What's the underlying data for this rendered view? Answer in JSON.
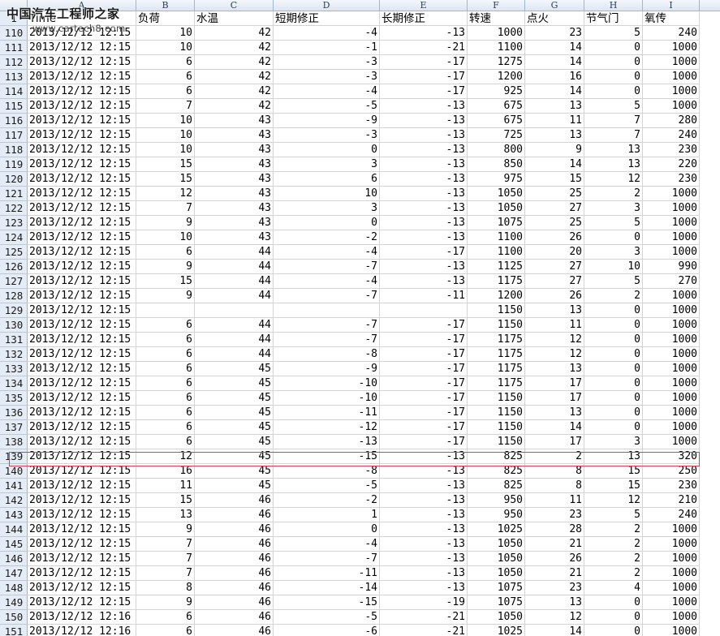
{
  "columns": [
    "A",
    "B",
    "C",
    "D",
    "E",
    "F",
    "G",
    "H",
    "I"
  ],
  "headers": [
    "Time",
    "负荷",
    "水温",
    "短期修正",
    "长期修正",
    "转速",
    "点火",
    "节气门",
    "氧传"
  ],
  "header_row_num": "1",
  "rows": [
    {
      "n": "110",
      "v": [
        "2013/12/12 12:15",
        "10",
        "42",
        "-4",
        "-13",
        "1000",
        "23",
        "5",
        "240"
      ]
    },
    {
      "n": "111",
      "v": [
        "2013/12/12 12:15",
        "10",
        "42",
        "-1",
        "-21",
        "1100",
        "14",
        "0",
        "1000"
      ]
    },
    {
      "n": "112",
      "v": [
        "2013/12/12 12:15",
        "6",
        "42",
        "-3",
        "-17",
        "1275",
        "14",
        "0",
        "1000"
      ]
    },
    {
      "n": "113",
      "v": [
        "2013/12/12 12:15",
        "6",
        "42",
        "-3",
        "-17",
        "1200",
        "16",
        "0",
        "1000"
      ]
    },
    {
      "n": "114",
      "v": [
        "2013/12/12 12:15",
        "6",
        "42",
        "-4",
        "-17",
        "925",
        "14",
        "0",
        "1000"
      ]
    },
    {
      "n": "115",
      "v": [
        "2013/12/12 12:15",
        "7",
        "42",
        "-5",
        "-13",
        "675",
        "13",
        "5",
        "1000"
      ]
    },
    {
      "n": "116",
      "v": [
        "2013/12/12 12:15",
        "10",
        "43",
        "-9",
        "-13",
        "675",
        "11",
        "7",
        "280"
      ]
    },
    {
      "n": "117",
      "v": [
        "2013/12/12 12:15",
        "10",
        "43",
        "-3",
        "-13",
        "725",
        "13",
        "7",
        "240"
      ]
    },
    {
      "n": "118",
      "v": [
        "2013/12/12 12:15",
        "10",
        "43",
        "0",
        "-13",
        "800",
        "9",
        "13",
        "230"
      ]
    },
    {
      "n": "119",
      "v": [
        "2013/12/12 12:15",
        "15",
        "43",
        "3",
        "-13",
        "850",
        "14",
        "13",
        "220"
      ]
    },
    {
      "n": "120",
      "v": [
        "2013/12/12 12:15",
        "15",
        "43",
        "6",
        "-13",
        "975",
        "15",
        "12",
        "230"
      ]
    },
    {
      "n": "121",
      "v": [
        "2013/12/12 12:15",
        "12",
        "43",
        "10",
        "-13",
        "1050",
        "25",
        "2",
        "1000"
      ]
    },
    {
      "n": "122",
      "v": [
        "2013/12/12 12:15",
        "7",
        "43",
        "3",
        "-13",
        "1050",
        "27",
        "3",
        "1000"
      ]
    },
    {
      "n": "123",
      "v": [
        "2013/12/12 12:15",
        "9",
        "43",
        "0",
        "-13",
        "1075",
        "25",
        "5",
        "1000"
      ]
    },
    {
      "n": "124",
      "v": [
        "2013/12/12 12:15",
        "10",
        "43",
        "-2",
        "-13",
        "1100",
        "26",
        "0",
        "1000"
      ]
    },
    {
      "n": "125",
      "v": [
        "2013/12/12 12:15",
        "6",
        "44",
        "-4",
        "-17",
        "1100",
        "20",
        "3",
        "1000"
      ]
    },
    {
      "n": "126",
      "v": [
        "2013/12/12 12:15",
        "9",
        "44",
        "-7",
        "-13",
        "1125",
        "27",
        "10",
        "990"
      ]
    },
    {
      "n": "127",
      "v": [
        "2013/12/12 12:15",
        "15",
        "44",
        "-4",
        "-13",
        "1175",
        "27",
        "5",
        "270"
      ]
    },
    {
      "n": "128",
      "v": [
        "2013/12/12 12:15",
        "9",
        "44",
        "-7",
        "-11",
        "1200",
        "26",
        "2",
        "1000"
      ]
    },
    {
      "n": "129",
      "v": [
        "2013/12/12 12:15",
        "",
        "",
        "",
        "",
        "1150",
        "13",
        "0",
        "1000"
      ]
    },
    {
      "n": "130",
      "v": [
        "2013/12/12 12:15",
        "6",
        "44",
        "-7",
        "-17",
        "1150",
        "11",
        "0",
        "1000"
      ]
    },
    {
      "n": "131",
      "v": [
        "2013/12/12 12:15",
        "6",
        "44",
        "-7",
        "-17",
        "1175",
        "12",
        "0",
        "1000"
      ]
    },
    {
      "n": "132",
      "v": [
        "2013/12/12 12:15",
        "6",
        "44",
        "-8",
        "-17",
        "1175",
        "12",
        "0",
        "1000"
      ]
    },
    {
      "n": "133",
      "v": [
        "2013/12/12 12:15",
        "6",
        "45",
        "-9",
        "-17",
        "1175",
        "13",
        "0",
        "1000"
      ]
    },
    {
      "n": "134",
      "v": [
        "2013/12/12 12:15",
        "6",
        "45",
        "-10",
        "-17",
        "1175",
        "17",
        "0",
        "1000"
      ]
    },
    {
      "n": "135",
      "v": [
        "2013/12/12 12:15",
        "6",
        "45",
        "-10",
        "-17",
        "1150",
        "17",
        "0",
        "1000"
      ]
    },
    {
      "n": "136",
      "v": [
        "2013/12/12 12:15",
        "6",
        "45",
        "-11",
        "-17",
        "1150",
        "13",
        "0",
        "1000"
      ]
    },
    {
      "n": "137",
      "v": [
        "2013/12/12 12:15",
        "6",
        "45",
        "-12",
        "-17",
        "1150",
        "14",
        "0",
        "1000"
      ]
    },
    {
      "n": "138",
      "v": [
        "2013/12/12 12:15",
        "6",
        "45",
        "-13",
        "-17",
        "1150",
        "17",
        "3",
        "1000"
      ]
    },
    {
      "n": "139",
      "v": [
        "2013/12/12 12:15",
        "12",
        "45",
        "-15",
        "-13",
        "825",
        "2",
        "13",
        "320"
      ]
    },
    {
      "n": "140",
      "v": [
        "2013/12/12 12:15",
        "16",
        "45",
        "-8",
        "-13",
        "825",
        "8",
        "15",
        "250"
      ]
    },
    {
      "n": "141",
      "v": [
        "2013/12/12 12:15",
        "11",
        "45",
        "-5",
        "-13",
        "825",
        "8",
        "15",
        "230"
      ]
    },
    {
      "n": "142",
      "v": [
        "2013/12/12 12:15",
        "15",
        "46",
        "-2",
        "-13",
        "950",
        "11",
        "12",
        "210"
      ]
    },
    {
      "n": "143",
      "v": [
        "2013/12/12 12:15",
        "13",
        "46",
        "1",
        "-13",
        "950",
        "23",
        "5",
        "240"
      ]
    },
    {
      "n": "144",
      "v": [
        "2013/12/12 12:15",
        "9",
        "46",
        "0",
        "-13",
        "1025",
        "28",
        "2",
        "1000"
      ]
    },
    {
      "n": "145",
      "v": [
        "2013/12/12 12:15",
        "7",
        "46",
        "-4",
        "-13",
        "1050",
        "21",
        "2",
        "1000"
      ]
    },
    {
      "n": "146",
      "v": [
        "2013/12/12 12:15",
        "7",
        "46",
        "-7",
        "-13",
        "1050",
        "26",
        "2",
        "1000"
      ]
    },
    {
      "n": "147",
      "v": [
        "2013/12/12 12:15",
        "7",
        "46",
        "-11",
        "-13",
        "1050",
        "21",
        "2",
        "1000"
      ]
    },
    {
      "n": "148",
      "v": [
        "2013/12/12 12:15",
        "8",
        "46",
        "-14",
        "-13",
        "1075",
        "23",
        "4",
        "1000"
      ]
    },
    {
      "n": "149",
      "v": [
        "2013/12/12 12:15",
        "9",
        "46",
        "-15",
        "-19",
        "1075",
        "13",
        "0",
        "1000"
      ]
    },
    {
      "n": "150",
      "v": [
        "2013/12/12 12:16",
        "6",
        "46",
        "-5",
        "-21",
        "1050",
        "12",
        "0",
        "1000"
      ]
    },
    {
      "n": "151",
      "v": [
        "2013/12/12 12:16",
        "6",
        "46",
        "-6",
        "-21",
        "1025",
        "14",
        "0",
        "1000"
      ]
    }
  ],
  "highlighted_row": "139",
  "watermark": {
    "title": "中国汽车工程师之家",
    "url": "www.cartech8.com"
  }
}
